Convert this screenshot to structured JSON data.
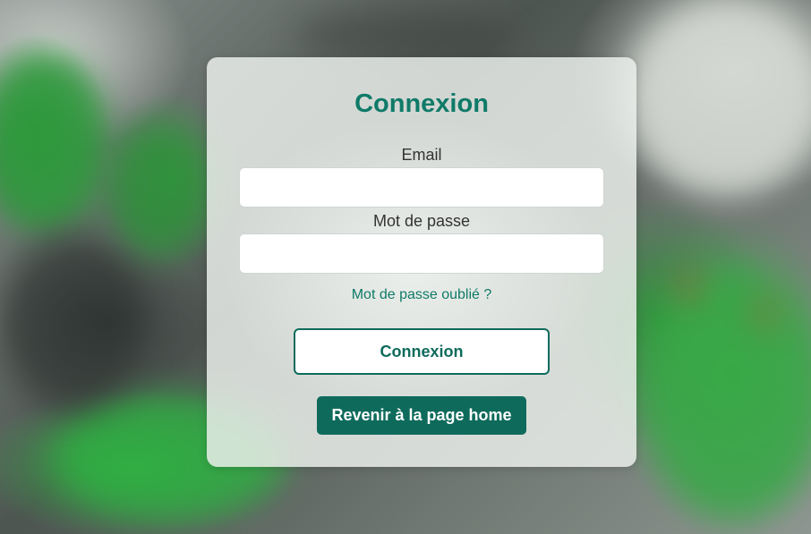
{
  "colors": {
    "brand": "#0f7a68",
    "button_dark": "#0e6b5c",
    "card_bg": "#ecf0ec"
  },
  "login": {
    "title": "Connexion",
    "email_label": "Email",
    "email_value": "",
    "password_label": "Mot de passe",
    "password_value": "",
    "forgot_link": "Mot de passe oublié ?",
    "submit_label": "Connexion",
    "home_label": "Revenir à la page home"
  }
}
